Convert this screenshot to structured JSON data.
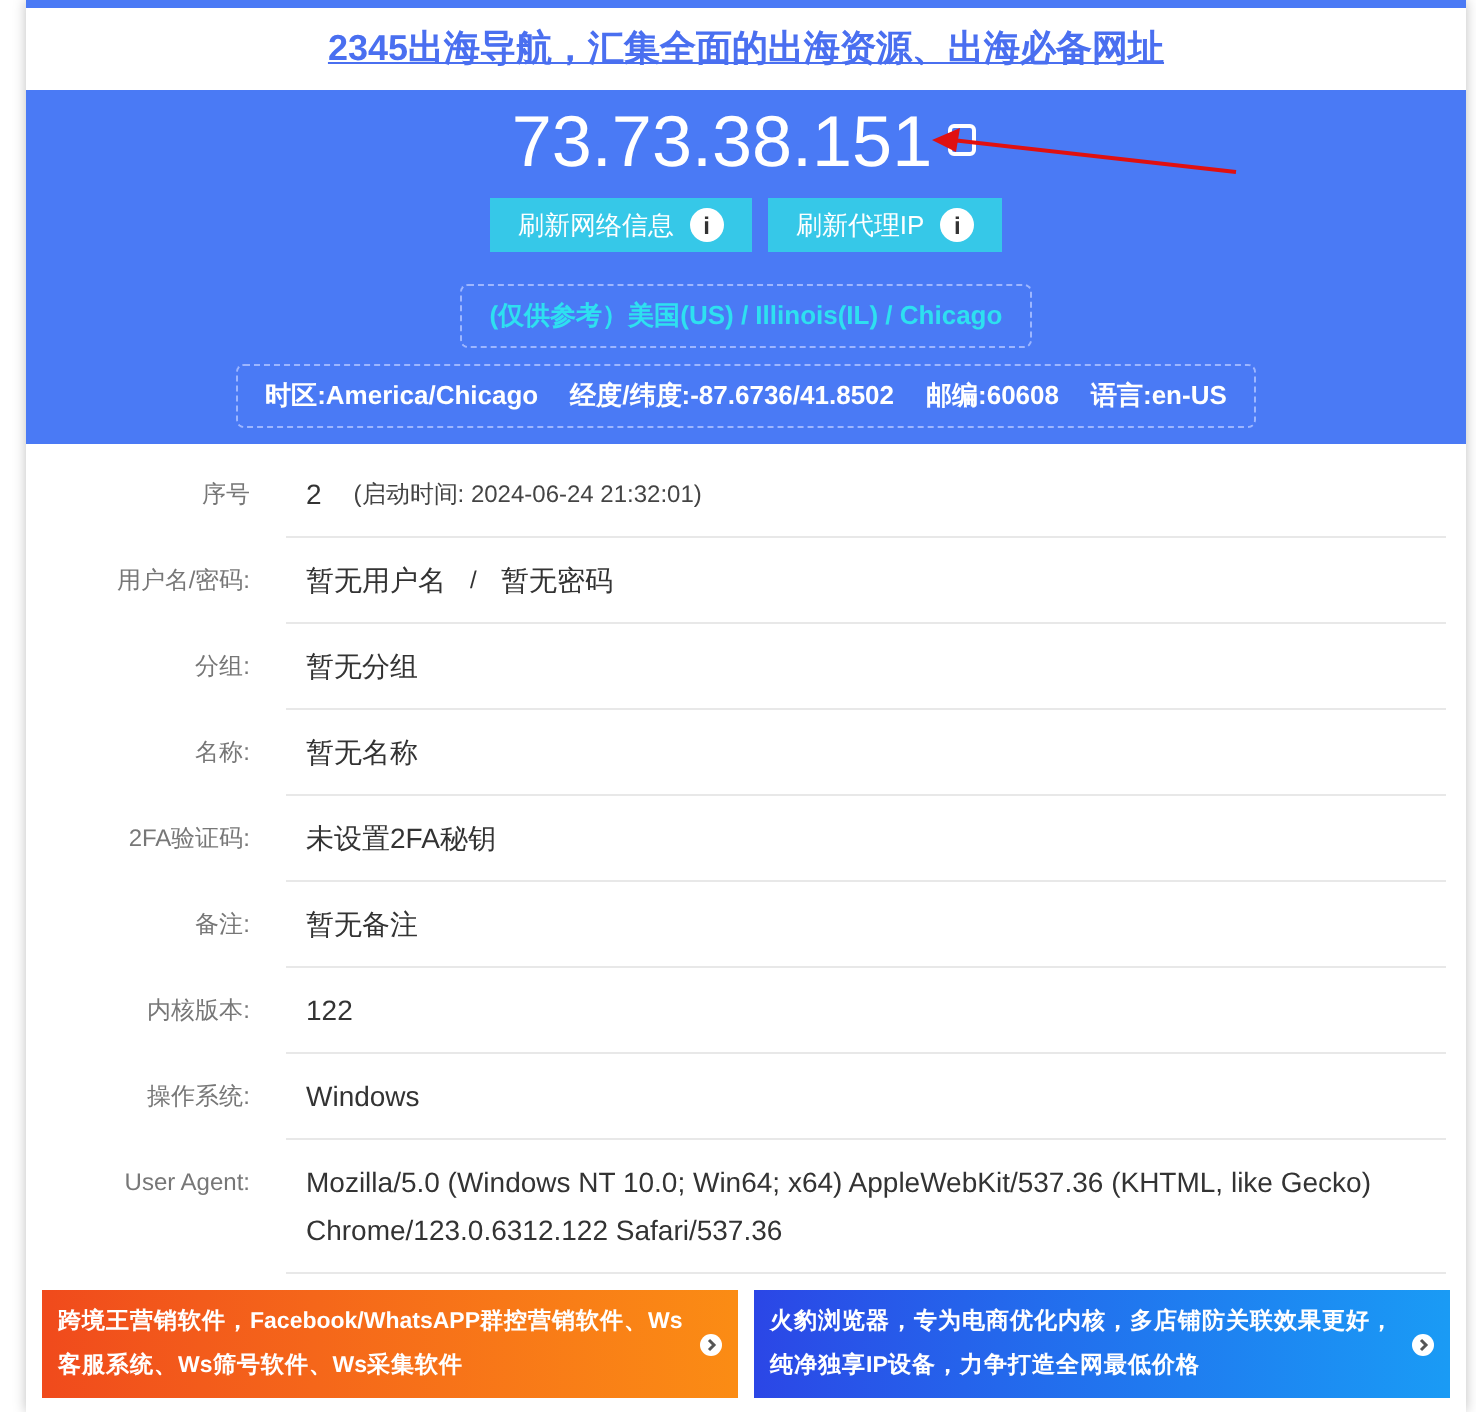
{
  "top_link": "2345出海导航，汇集全面的出海资源、出海必备网址",
  "ip": "73.73.38.151",
  "buttons": [
    {
      "label": "刷新网络信息",
      "info": "i"
    },
    {
      "label": "刷新代理IP",
      "info": "i"
    }
  ],
  "location": "(仅供参考）美国(US) / Illinois(IL) / Chicago",
  "geo": [
    "时区:America/Chicago",
    "经度/纬度:-87.6736/41.8502",
    "邮编:60608",
    "语言:en-US"
  ],
  "rows": [
    {
      "kind": "serial",
      "label": "序号",
      "value": "2",
      "note": "(启动时间: 2024-06-24 21:32:01)"
    },
    {
      "kind": "pair",
      "label": "用户名/密码:",
      "value": "暂无用户名",
      "separator": "/",
      "value2": "暂无密码"
    },
    {
      "kind": "plain",
      "label": "分组:",
      "value": "暂无分组"
    },
    {
      "kind": "plain",
      "label": "名称:",
      "value": "暂无名称"
    },
    {
      "kind": "plain",
      "label": "2FA验证码:",
      "value": "未设置2FA秘钥"
    },
    {
      "kind": "plain",
      "label": "备注:",
      "value": "暂无备注"
    },
    {
      "kind": "plain",
      "label": "内核版本:",
      "value": "122"
    },
    {
      "kind": "plain",
      "label": "操作系统:",
      "value": "Windows"
    },
    {
      "kind": "plain",
      "label": "User Agent:",
      "value": "Mozilla/5.0 (Windows NT 10.0; Win64; x64) AppleWebKit/537.36 (KHTML, like Gecko) Chrome/123.0.6312.122 Safari/537.36"
    }
  ],
  "banners": [
    {
      "kind": "orange",
      "text": "跨境王营销软件，Facebook/WhatsAPP群控营销软件、Ws客服系统、Ws筛号软件、Ws采集软件"
    },
    {
      "kind": "blue",
      "text": "火豹浏览器，专为电商优化内核，多店铺防关联效果更好，纯净独享IP设备，力争打造全网最低价格"
    }
  ]
}
